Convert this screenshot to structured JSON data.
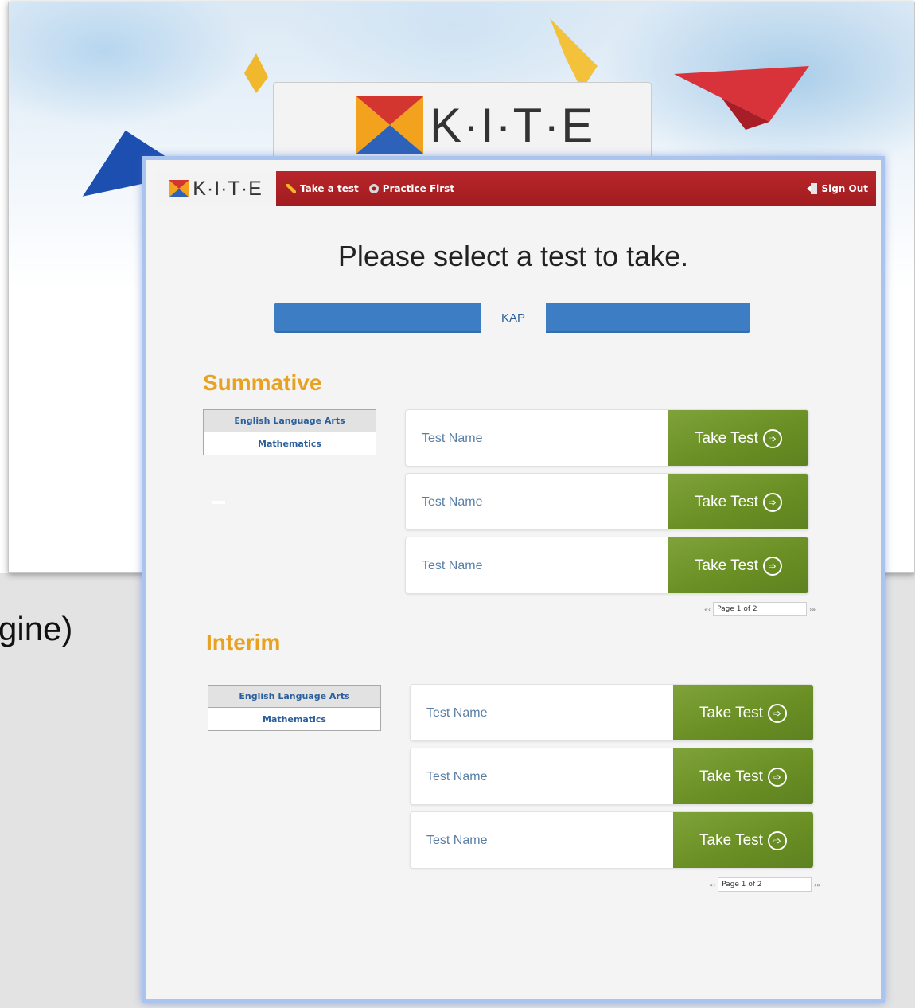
{
  "background": {
    "logo_text": "K·I·T·E",
    "fragment_text": "gine)"
  },
  "topbar": {
    "brand_text": "K·I·T·E",
    "nav": {
      "take_test_label": "Take a test",
      "practice_first_label": "Practice First",
      "sign_out_label": "Sign Out"
    }
  },
  "main": {
    "title": "Please select a test to take.",
    "program_tab": "KAP"
  },
  "summative": {
    "title": "Summative",
    "subjects": [
      "English Language Arts",
      "Mathematics"
    ],
    "tests": [
      {
        "name": "Test Name",
        "button": "Take Test"
      },
      {
        "name": "Test Name",
        "button": "Take Test"
      },
      {
        "name": "Test Name",
        "button": "Take Test"
      }
    ],
    "pager": {
      "text": "Page 1 of 2",
      "prev": "«‹",
      "next": "›»"
    }
  },
  "interim": {
    "title": "Interim",
    "subjects": [
      "English Language Arts",
      "Mathematics"
    ],
    "tests": [
      {
        "name": "Test Name",
        "button": "Take Test"
      },
      {
        "name": "Test Name",
        "button": "Take Test"
      },
      {
        "name": "Test Name",
        "button": "Take Test"
      }
    ],
    "pager": {
      "text": "Page 1 of 2",
      "prev": "«‹",
      "next": "›»"
    }
  },
  "colors": {
    "topbar_red": "#b8262a",
    "program_blue": "#3c7dc4",
    "button_green": "#6a8f24",
    "section_orange": "#e8a120"
  }
}
